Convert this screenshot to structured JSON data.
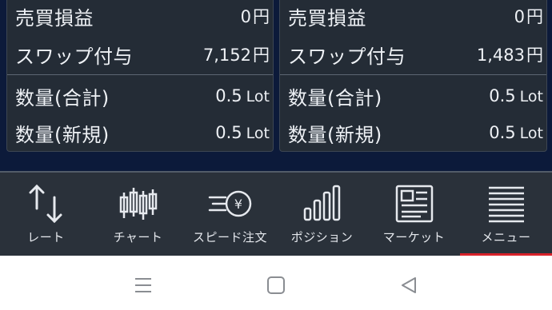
{
  "positions": [
    {
      "pnl_label": "売買損益",
      "pnl_value": "0",
      "pnl_unit": "円",
      "swap_label": "スワップ付与",
      "swap_value": "7,152",
      "swap_unit": "円",
      "qty_total_label": "数量(合計)",
      "qty_total_value": "0.5",
      "qty_total_unit": "Lot",
      "qty_new_label": "数量(新規)",
      "qty_new_value": "0.5",
      "qty_new_unit": "Lot"
    },
    {
      "pnl_label": "売買損益",
      "pnl_value": "0",
      "pnl_unit": "円",
      "swap_label": "スワップ付与",
      "swap_value": "1,483",
      "swap_unit": "円",
      "qty_total_label": "数量(合計)",
      "qty_total_value": "0.5",
      "qty_total_unit": "Lot",
      "qty_new_label": "数量(新規)",
      "qty_new_value": "0.5",
      "qty_new_unit": "Lot"
    }
  ],
  "nav": {
    "items": [
      {
        "label": "レート",
        "icon": "rate-arrows-icon"
      },
      {
        "label": "チャート",
        "icon": "candlestick-icon"
      },
      {
        "label": "スピード注文",
        "icon": "speed-order-yen-icon"
      },
      {
        "label": "ポジション",
        "icon": "position-bars-icon"
      },
      {
        "label": "マーケット",
        "icon": "market-news-icon"
      },
      {
        "label": "メニュー",
        "icon": "menu-icon"
      }
    ],
    "active_index": 5
  },
  "system_bar": {
    "icons": [
      "recent-apps-icon",
      "home-icon",
      "back-icon"
    ]
  },
  "colors": {
    "background": "#0c1a3a",
    "card": "#242c36",
    "navbar": "#2a313a",
    "active_indicator": "#d8222a"
  }
}
